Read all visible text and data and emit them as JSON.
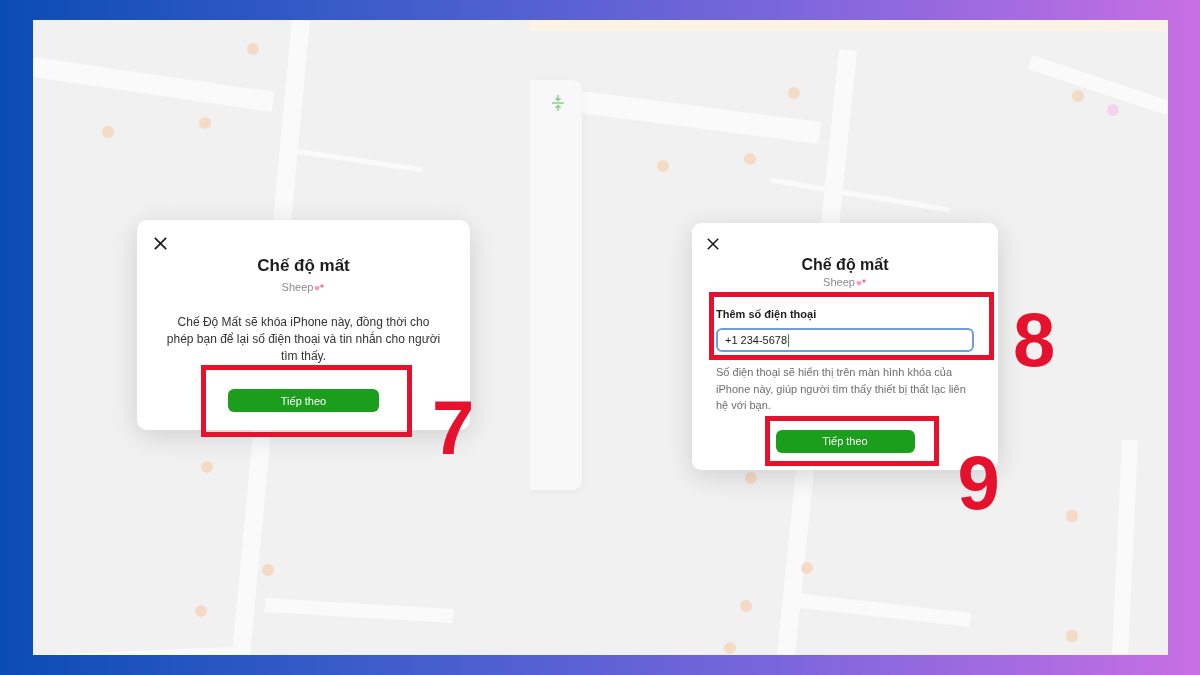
{
  "panels": [
    {
      "dialog": {
        "title": "Chế độ mất",
        "device": "Sheep",
        "message": "Chế Độ Mất sẽ khóa iPhone này, đồng thời cho phép bạn để lại số điện thoại và tin nhắn cho người tìm thấy.",
        "button": {
          "label": "Tiếp theo",
          "step": "7"
        }
      }
    },
    {
      "dialog": {
        "title": "Chế độ mất",
        "device": "Sheep",
        "phone_field": {
          "label": "Thêm số điện thoại",
          "value": "+1 234-5678",
          "focused": true,
          "step": "8"
        },
        "message": "Số điện thoại sẽ hiển thị trên màn hình khóa của iPhone này, giúp người tìm thấy thiết bị thất lạc liên hệ với bạn.",
        "button": {
          "label": "Tiếp theo",
          "step": "9"
        }
      }
    }
  ]
}
